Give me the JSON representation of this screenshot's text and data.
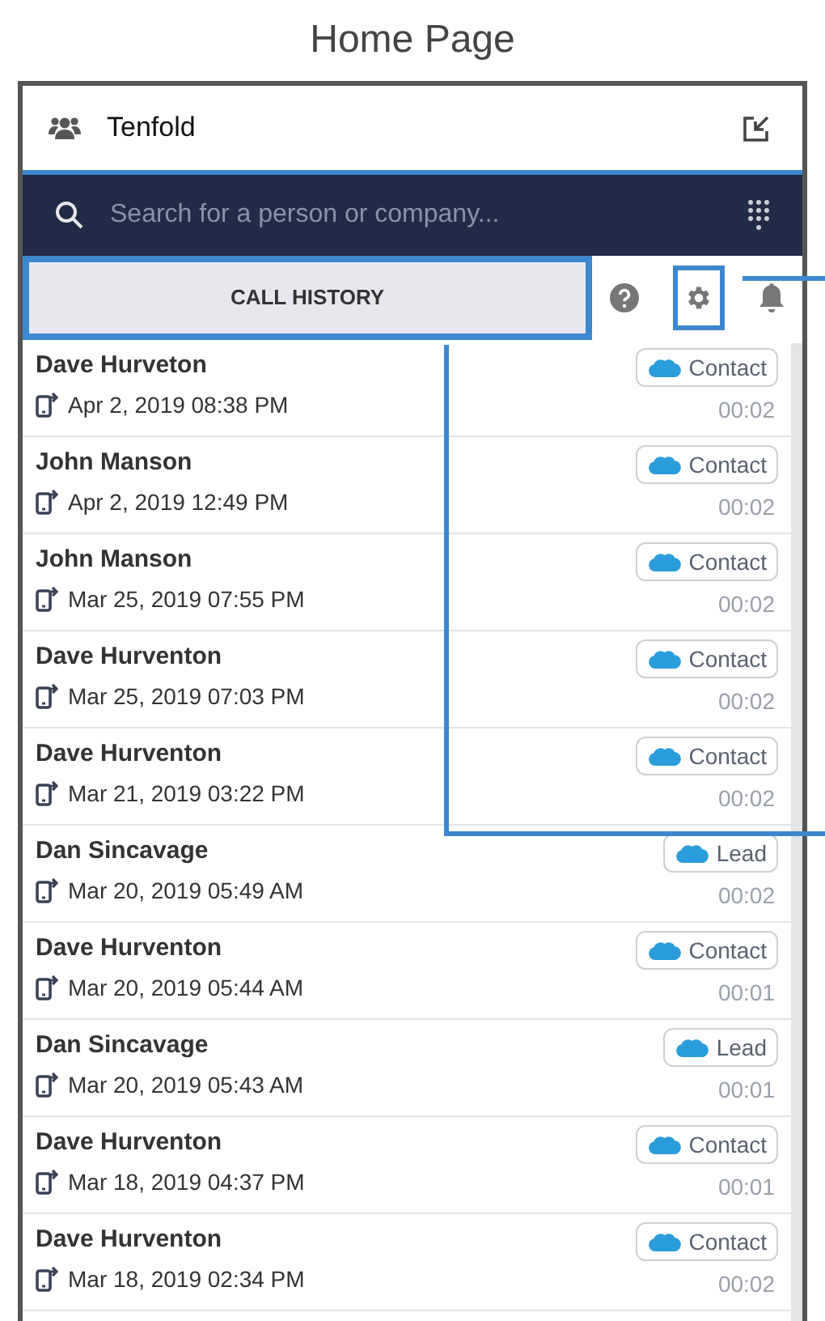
{
  "page_title": "Home Page",
  "header": {
    "title": "Tenfold"
  },
  "search": {
    "placeholder": "Search for a person or company..."
  },
  "tabs": [
    {
      "label": "CALL HISTORY",
      "selected": true
    }
  ],
  "calls": [
    {
      "name": "Dave Hurveton",
      "date": "Apr 2, 2019 08:38 PM",
      "badge": "Contact",
      "duration": "00:02"
    },
    {
      "name": "John Manson",
      "date": "Apr 2, 2019 12:49 PM",
      "badge": "Contact",
      "duration": "00:02"
    },
    {
      "name": "John Manson",
      "date": "Mar 25, 2019 07:55 PM",
      "badge": "Contact",
      "duration": "00:02"
    },
    {
      "name": "Dave Hurventon",
      "date": "Mar 25, 2019 07:03 PM",
      "badge": "Contact",
      "duration": "00:02"
    },
    {
      "name": "Dave Hurventon",
      "date": "Mar 21, 2019 03:22 PM",
      "badge": "Contact",
      "duration": "00:02"
    },
    {
      "name": "Dan Sincavage",
      "date": "Mar 20, 2019 05:49 AM",
      "badge": "Lead",
      "duration": "00:02"
    },
    {
      "name": "Dave Hurventon",
      "date": "Mar 20, 2019 05:44 AM",
      "badge": "Contact",
      "duration": "00:01"
    },
    {
      "name": "Dan Sincavage",
      "date": "Mar 20, 2019 05:43 AM",
      "badge": "Lead",
      "duration": "00:01"
    },
    {
      "name": "Dave Hurventon",
      "date": "Mar 18, 2019 04:37 PM",
      "badge": "Contact",
      "duration": "00:01"
    },
    {
      "name": "Dave Hurventon",
      "date": "Mar 18, 2019 02:34 PM",
      "badge": "Contact",
      "duration": "00:02"
    }
  ]
}
